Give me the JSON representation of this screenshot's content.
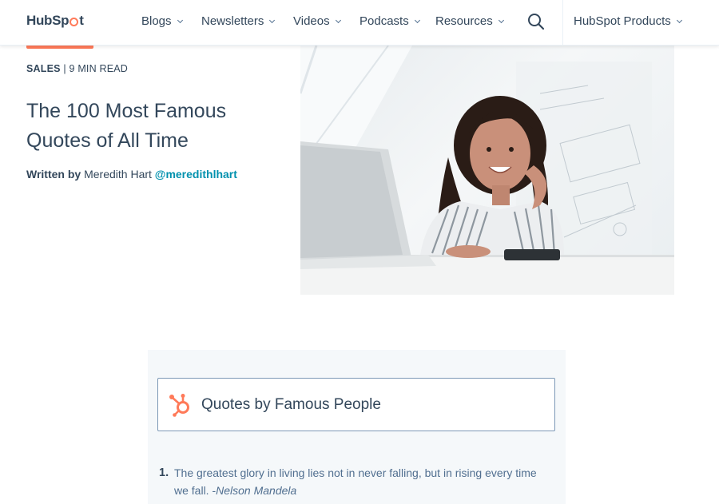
{
  "header": {
    "logo": {
      "text_pre": "HubSp",
      "text_post": "t"
    },
    "nav": [
      {
        "label": "Blogs"
      },
      {
        "label": "Newsletters"
      },
      {
        "label": "Videos"
      },
      {
        "label": "Podcasts"
      },
      {
        "label": "Resources"
      }
    ],
    "products_label": "HubSpot Products"
  },
  "article": {
    "category": "SALES",
    "read_time": "9 MIN READ",
    "title": "The 100 Most Famous Quotes of All Time",
    "written_by": "Written by",
    "author": "Meredith Hart",
    "handle": "@meredithlhart"
  },
  "toc": {
    "card_label": "Quotes by Famous People",
    "first_item": {
      "number": "1.",
      "text": "The greatest glory in living lies not in never falling, but in rising every time we fall. -",
      "author": "Nelson Mandela"
    }
  },
  "colors": {
    "accent": "#ff7a59",
    "link": "#0091ae",
    "text": "#33475b"
  }
}
